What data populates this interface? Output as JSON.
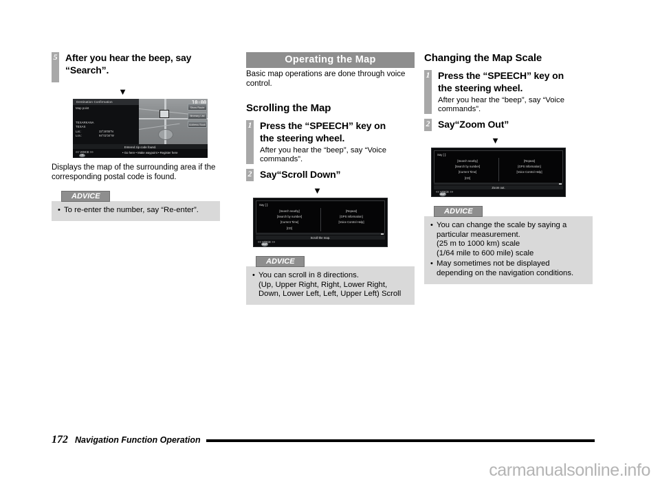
{
  "page": {
    "number": "172",
    "running_title": "Navigation Function Operation",
    "watermark": "carmanualsonline.info"
  },
  "column1": {
    "step5": {
      "number": "5",
      "title_line1": "After you hear the beep, say",
      "title_line2": "“Search”."
    },
    "arrow": "▼",
    "screenshot": {
      "name": "destination-confirmation-screen",
      "title": "Destination Confirmation",
      "subtitle": "Map point",
      "city": "TEXARKANA",
      "state": "TEXAS",
      "lat_label": "Lat.:",
      "lat_value": "33°28'08\"N",
      "lon_label": "Lon.:",
      "lon_value": "94°02'34\"W",
      "clock": "10:00",
      "buttons": [
        "Show Route",
        "Itinerary List",
        "Address Book"
      ],
      "status": "Entered zip code found.",
      "voice_label": "<< VOICE >>",
      "ok_label": "OK",
      "options": "• Go here  • Make waypoint  • Register here"
    },
    "caption": "Displays the map of the surrounding area if the corresponding postal code is found.",
    "advice": {
      "tag": "ADVICE",
      "items": [
        {
          "text": "To re-enter the number, say “Re-enter”."
        }
      ]
    }
  },
  "column2": {
    "section_title": "Operating the Map",
    "section_lead": "Basic map operations are done through voice control.",
    "subhead": "Scrolling the Map",
    "step1": {
      "number": "1",
      "title_line1": "Press the “SPEECH” key on",
      "title_line2": "the steering wheel.",
      "body": "After you hear the “beep”, say “Voice commands”."
    },
    "step2": {
      "number": "2",
      "title": "Say“Scroll Down”"
    },
    "arrow": "▼",
    "screenshot": {
      "name": "voice-command-scroll-screen",
      "say_label": "Say [ ]:",
      "left_commands": [
        "[Search nearby]",
        "[Search by number]",
        "[Current Time]",
        "[CD]"
      ],
      "right_commands": [
        "[Repeat]",
        "[GPS Information]",
        "[Voice Control Help]"
      ],
      "status": "Scroll the map.",
      "voice_label": "<< VOICE >>",
      "map_label": "MAP"
    },
    "advice": {
      "tag": "ADVICE",
      "items": [
        {
          "text": "You can scroll in 8 directions.",
          "sub": "(Up, Upper Right, Right, Lower Right, Down, Lower Left, Left, Upper Left) Scroll"
        }
      ]
    }
  },
  "column3": {
    "subhead": "Changing the Map Scale",
    "step1": {
      "number": "1",
      "title_line1": "Press the “SPEECH” key on",
      "title_line2": "the steering wheel.",
      "body": "After you hear the “beep”, say “Voice commands”."
    },
    "step2": {
      "number": "2",
      "title": "Say“Zoom Out”"
    },
    "arrow": "▼",
    "screenshot": {
      "name": "voice-command-zoom-screen",
      "say_label": "Say [ ]:",
      "left_commands": [
        "[Search nearby]",
        "[Search by number]",
        "[Current Time]",
        "[CD]"
      ],
      "right_commands": [
        "[Repeat]",
        "[GPS Information]",
        "[Voice Control Help]"
      ],
      "status": "Zoom out.",
      "voice_label": "<< VOICE >>",
      "map_label": "MAP"
    },
    "advice": {
      "tag": "ADVICE",
      "items": [
        {
          "text": "You can change the scale by saying a particular measurement.",
          "sub": "(25 m to 1000 km) scale",
          "sub2": "(1/64 mile to 600 mile) scale"
        },
        {
          "text": "May sometimes not be displayed depending on the navigation conditions."
        }
      ]
    }
  },
  "colors": {
    "banner_grey": "#8e8e8e",
    "advice_bg": "#d9d9d9",
    "step_rail": "#a8a8a8",
    "watermark_grey": "#b4b4b4"
  }
}
